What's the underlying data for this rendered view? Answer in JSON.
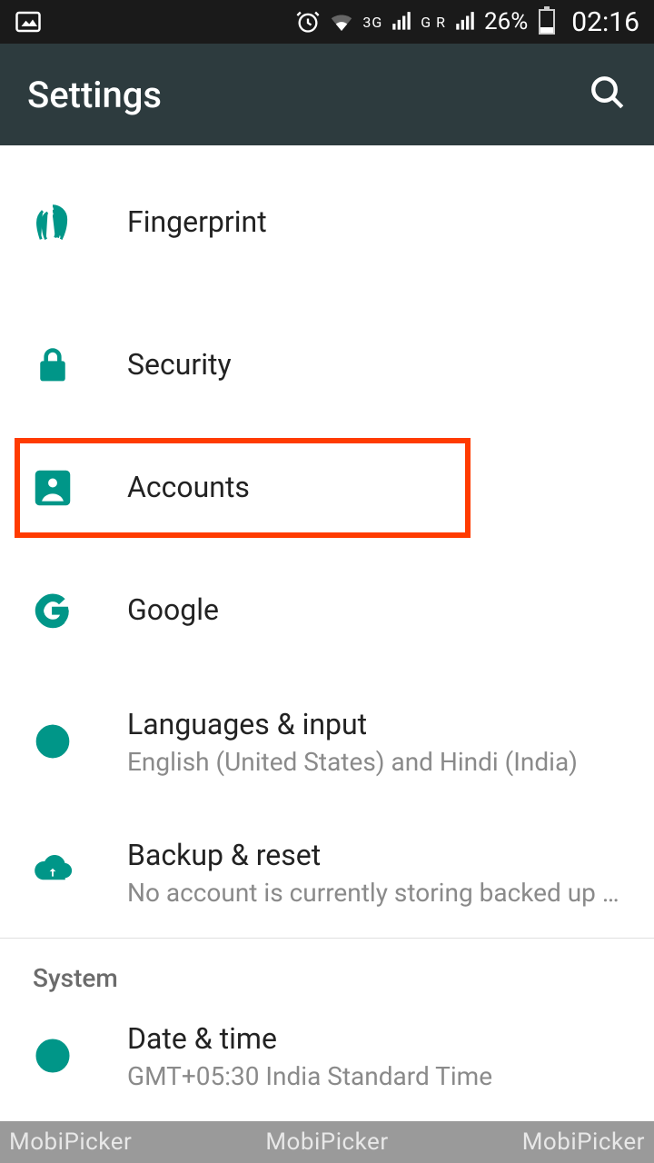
{
  "status": {
    "network1_label": "3G",
    "network2_label": "G R",
    "battery_pct": "26%",
    "time": "02:16"
  },
  "header": {
    "title": "Settings"
  },
  "items": {
    "fingerprint": {
      "label": "Fingerprint"
    },
    "security": {
      "label": "Security"
    },
    "accounts": {
      "label": "Accounts"
    },
    "google": {
      "label": "Google"
    },
    "languages": {
      "label": "Languages & input",
      "sub": "English (United States) and Hindi (India)"
    },
    "backup": {
      "label": "Backup & reset",
      "sub": "No account is currently storing backed up …"
    },
    "datetime": {
      "label": "Date & time",
      "sub": "GMT+05:30 India Standard Time"
    }
  },
  "section": {
    "system": "System"
  },
  "colors": {
    "accent": "#009688",
    "highlight": "#ff3b00"
  },
  "watermark": "MobiPicker"
}
